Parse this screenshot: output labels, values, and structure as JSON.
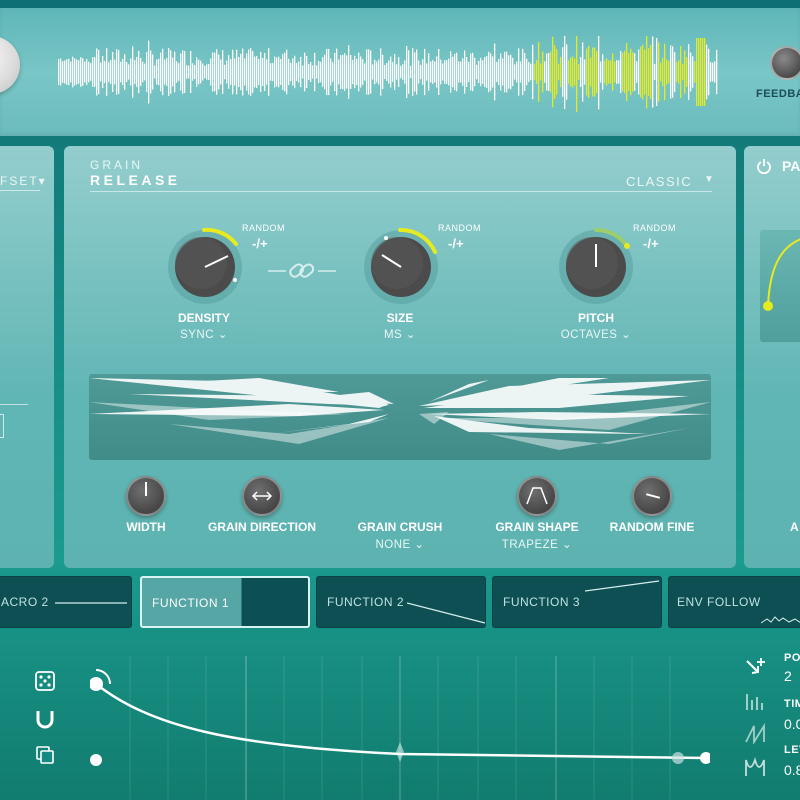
{
  "header": {
    "feedback_label": "FEEDBA"
  },
  "left_panel": {
    "offset_label": "FSET"
  },
  "grain": {
    "title_small": "GRAIN",
    "title_big": "RELEASE",
    "mode": "CLASSIC",
    "knobs": [
      {
        "label": "DENSITY",
        "sub": "SYNC",
        "random_label": "RANDOM",
        "random_value": "-/+"
      },
      {
        "label": "SIZE",
        "sub": "MS",
        "random_label": "RANDOM",
        "random_value": "-/+"
      },
      {
        "label": "PITCH",
        "sub": "OCTAVES",
        "random_label": "RANDOM",
        "random_value": "-/+"
      }
    ],
    "small_knobs": [
      {
        "label": "WIDTH",
        "sub": ""
      },
      {
        "label": "GRAIN DIRECTION",
        "sub": ""
      },
      {
        "label": "GRAIN CRUSH",
        "sub": "NONE"
      },
      {
        "label": "GRAIN SHAPE",
        "sub": "TRAPEZE"
      },
      {
        "label": "RANDOM FINE",
        "sub": ""
      }
    ]
  },
  "right_panel": {
    "title": "PA",
    "bottom_label": "A"
  },
  "tabs": [
    {
      "label": "ACRO 2"
    },
    {
      "label": "FUNCTION 1"
    },
    {
      "label": "FUNCTION 2"
    },
    {
      "label": "FUNCTION 3"
    },
    {
      "label": "ENV FOLLOW"
    }
  ],
  "envelope": {
    "side_icons": [
      "dice-icon",
      "magnet-icon",
      "copy-icon"
    ],
    "right_icons": [
      "add-point-icon",
      "bars-icon",
      "ramp-icon",
      "curve-icon"
    ],
    "params": [
      {
        "label": "PO",
        "value": "2"
      },
      {
        "label": "TIM",
        "value": "0.0"
      },
      {
        "label": "LEV",
        "value": "0.8"
      }
    ]
  },
  "colors": {
    "accent_yellow": "#e6ea1f",
    "panel_teal": "#7fc7c6",
    "tab_dark": "#0d4f52"
  }
}
